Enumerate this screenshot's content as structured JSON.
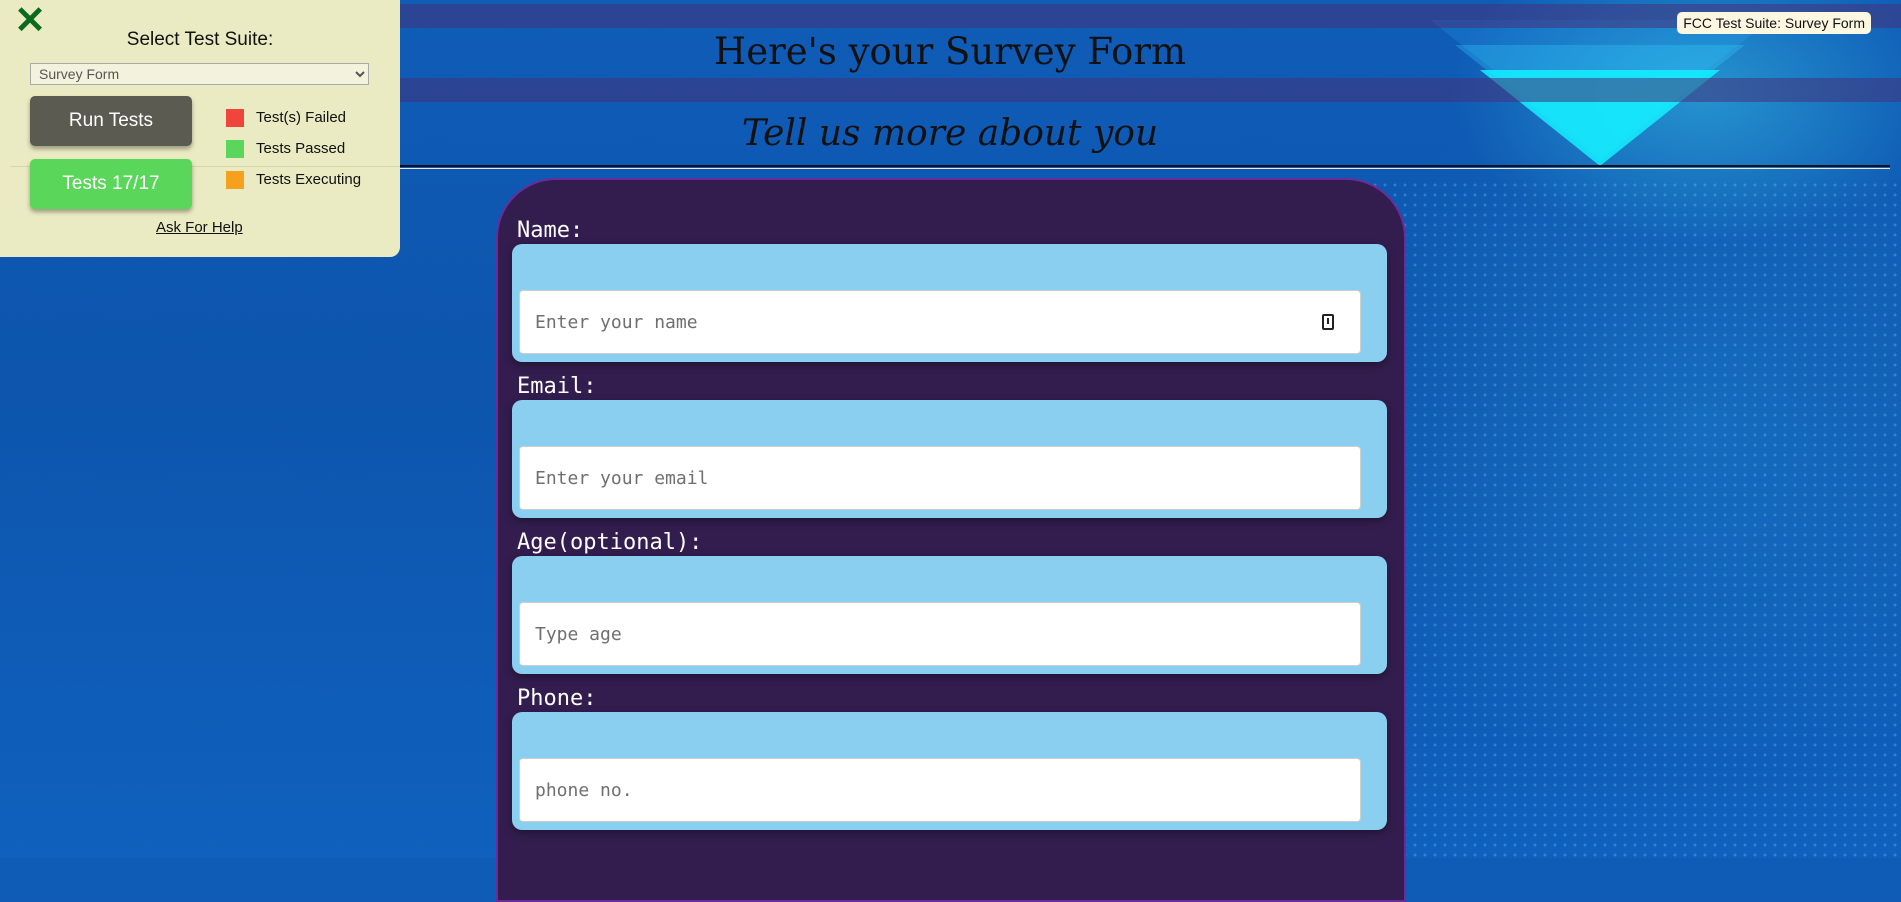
{
  "header": {
    "title": "Here's your Survey Form",
    "subtitle": "Tell us more about you",
    "fcc_tag": "FCC Test Suite: Survey Form"
  },
  "form": {
    "fields": [
      {
        "label": "Name:",
        "placeholder": "Enter your name",
        "value": "",
        "icon": "autofill-contact-icon"
      },
      {
        "label": "Email:",
        "placeholder": "Enter your email",
        "value": ""
      },
      {
        "label": "Age(optional):",
        "placeholder": "Type age",
        "value": ""
      },
      {
        "label": "Phone:",
        "placeholder": "phone no.",
        "value": ""
      }
    ]
  },
  "test_panel": {
    "close_icon": "close-icon",
    "title": "Select Test Suite:",
    "suite_select": {
      "selected": "Survey Form"
    },
    "run_button": "Run Tests",
    "tests_button": "Tests 17/17",
    "legend": [
      {
        "label": "Test(s) Failed",
        "color": "#f0453a"
      },
      {
        "label": "Tests Passed",
        "color": "#5ad65a"
      },
      {
        "label": "Tests Executing",
        "color": "#f5a11e"
      }
    ],
    "help_link": "Ask For Help"
  },
  "colors": {
    "background": "#0f5cb7",
    "form_card": "#321d4e",
    "field_box": "#8acfef",
    "panel": "#ebebc3",
    "close_icon": "#0a6b1c"
  }
}
